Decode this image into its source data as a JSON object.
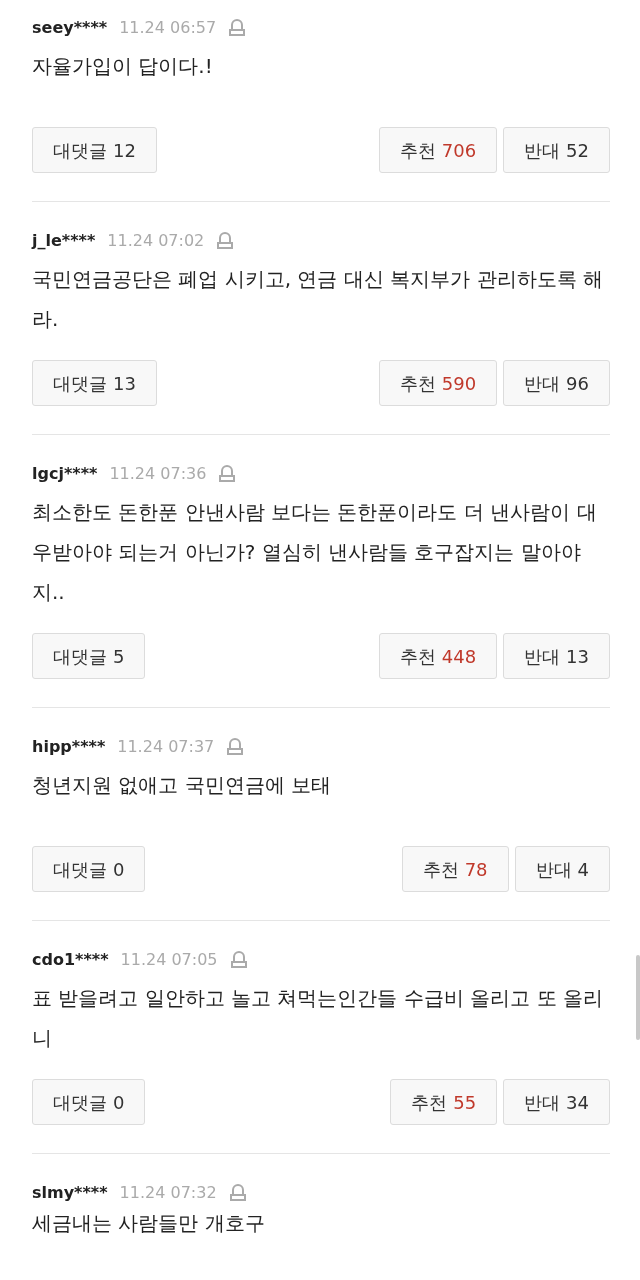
{
  "comments": [
    {
      "user": "seey****",
      "time": "11.24 06:57",
      "text": "자율가입이 답이다.!",
      "reply": {
        "label": "대댓글",
        "count": "12"
      },
      "like": {
        "label": "추천",
        "count": "706"
      },
      "dislike": {
        "label": "반대",
        "count": "52"
      }
    },
    {
      "user": "j_le****",
      "time": "11.24 07:02",
      "text": "국민연금공단은 폐업 시키고, 연금 대신 복지부가 관리하도록 해라.",
      "reply": {
        "label": "대댓글",
        "count": "13"
      },
      "like": {
        "label": "추천",
        "count": "590"
      },
      "dislike": {
        "label": "반대",
        "count": "96"
      }
    },
    {
      "user": "lgcj****",
      "time": "11.24 07:36",
      "text": "최소한도 돈한푼 안낸사람 보다는 돈한푼이라도 더 낸사람이 대우받아야 되는거 아닌가? 열심히 낸사람들 호구잡지는 말아야지..",
      "reply": {
        "label": "대댓글",
        "count": "5"
      },
      "like": {
        "label": "추천",
        "count": "448"
      },
      "dislike": {
        "label": "반대",
        "count": "13"
      }
    },
    {
      "user": "hipp****",
      "time": "11.24 07:37",
      "text": "청년지원 없애고 국민연금에 보태",
      "reply": {
        "label": "대댓글",
        "count": "0"
      },
      "like": {
        "label": "추천",
        "count": "78"
      },
      "dislike": {
        "label": "반대",
        "count": "4"
      }
    },
    {
      "user": "cdo1****",
      "time": "11.24 07:05",
      "text": "표 받을려고 일안하고 놀고 쳐먹는인간들 수급비 올리고 또 올리니",
      "reply": {
        "label": "대댓글",
        "count": "0"
      },
      "like": {
        "label": "추천",
        "count": "55"
      },
      "dislike": {
        "label": "반대",
        "count": "34"
      }
    },
    {
      "user": "slmy****",
      "time": "11.24 07:32",
      "text": "세금내는 사람들만 개호구"
    }
  ]
}
